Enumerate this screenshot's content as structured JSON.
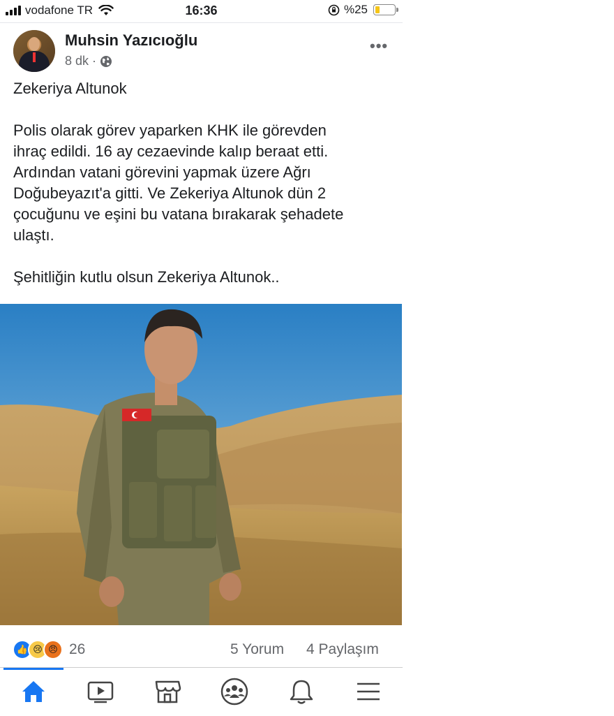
{
  "status_bar": {
    "carrier": "vodafone TR",
    "time": "16:36",
    "battery": "%25",
    "battery_level": 0.25
  },
  "post": {
    "author": "Muhsin Yazıcıoğlu",
    "time_ago": "8 dk",
    "separator": "·",
    "privacy_icon": "globe-icon",
    "more_icon": "more-icon",
    "text_lines": {
      "title": "Zekeriya Altunok",
      "p1": "Polis olarak görev yaparken KHK ile görevden",
      "p2": "ihraç edildi. 16 ay cezaevinde kalıp beraat etti.",
      "p3": "Ardından vatani görevini yapmak üzere Ağrı",
      "p4": "Doğubeyazıt'a gitti. Ve Zekeriya Altunok dün 2",
      "p5": "çocuğunu ve eşini bu vatana bırakarak şehadete",
      "p6": "ulaştı.",
      "closing": "Şehitliğin kutlu olsun Zekeriya Altunok.."
    },
    "photo_alt_icon": "soldier-photo",
    "reactions": {
      "icons": [
        "like-icon",
        "sad-icon",
        "angry-icon"
      ],
      "count": "26",
      "comments": "5 Yorum",
      "shares": "4 Paylaşım"
    }
  },
  "tabbar": {
    "tabs": [
      "home-icon",
      "video-icon",
      "marketplace-icon",
      "groups-icon",
      "notifications-icon",
      "menu-icon"
    ],
    "active": "home-icon",
    "accent": "#1877f2"
  }
}
